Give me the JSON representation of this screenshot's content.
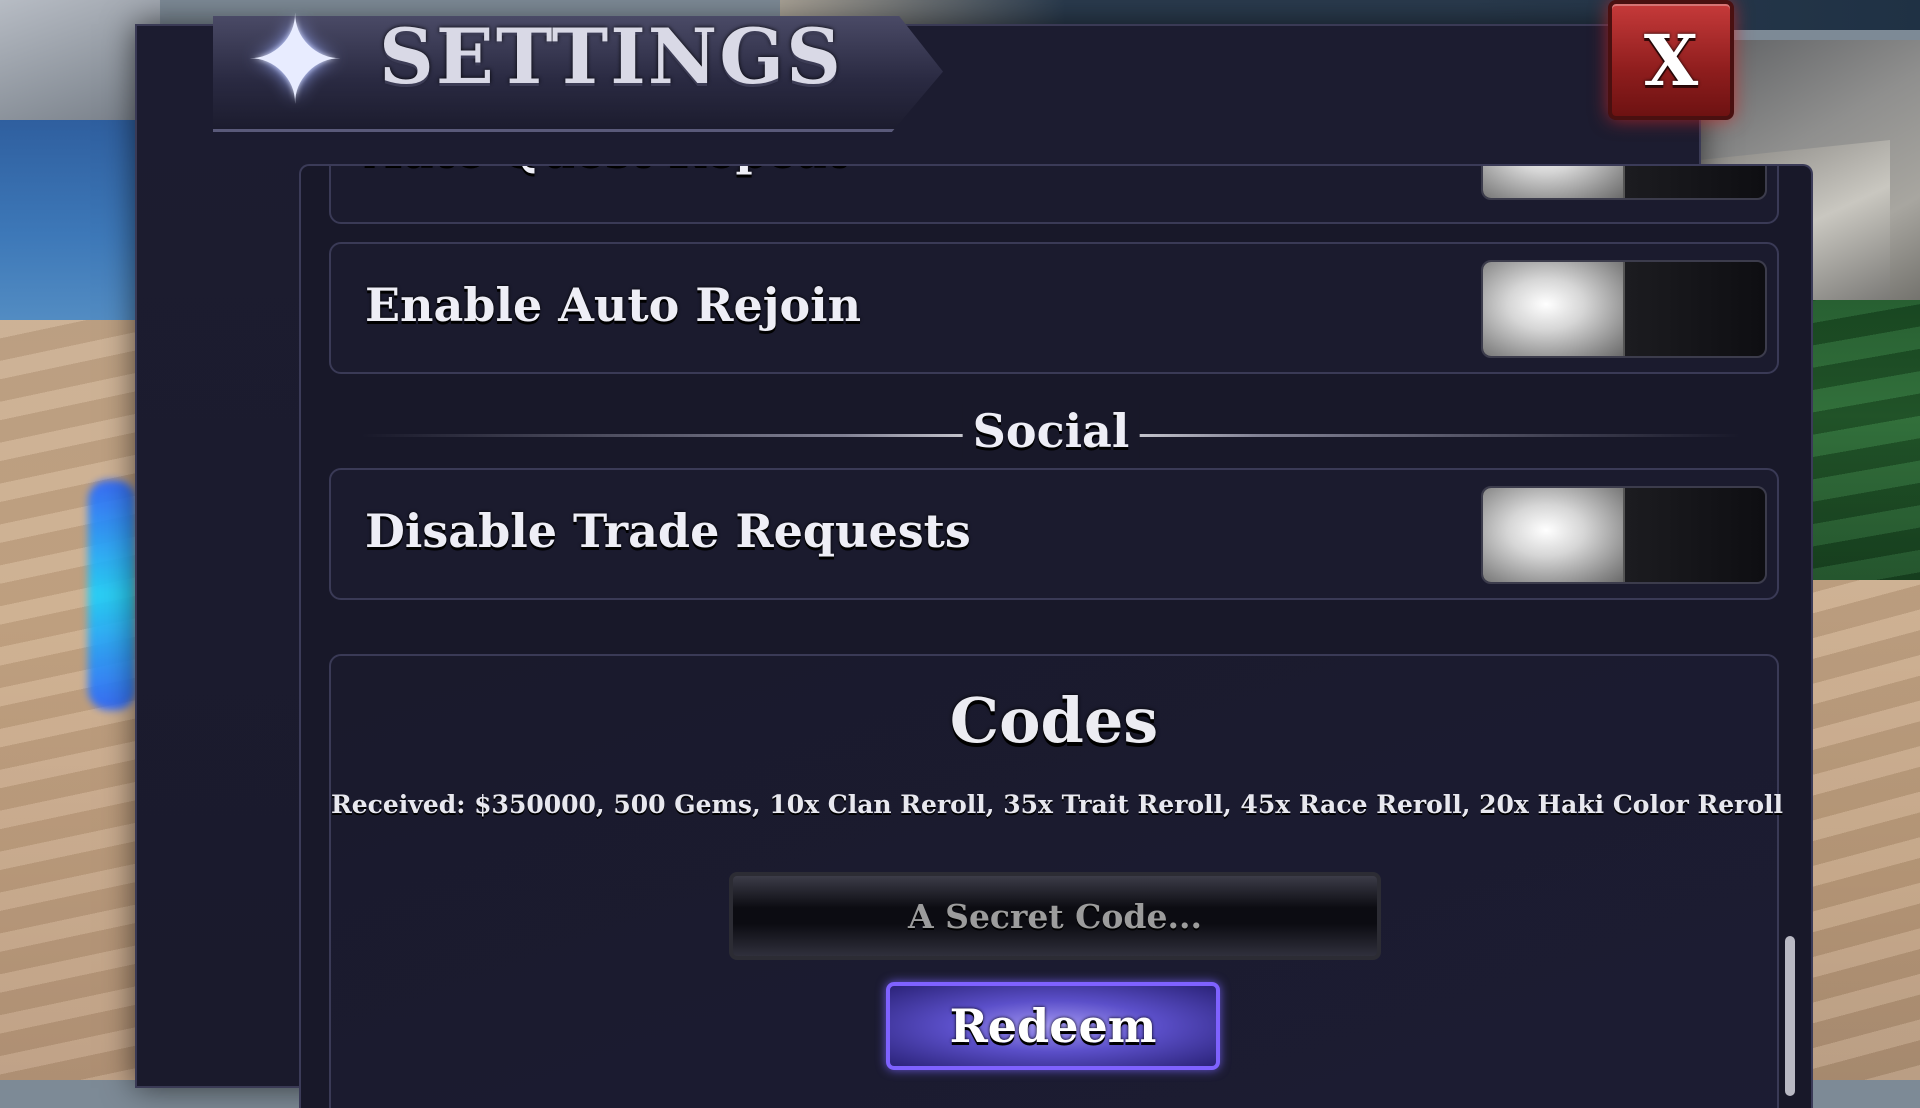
{
  "window": {
    "title": "SETTINGS",
    "close_label": "X"
  },
  "settings": {
    "rows": [
      {
        "label": "Auto Quest Repeat",
        "enabled": false
      },
      {
        "label": "Enable Auto Rejoin",
        "enabled": false
      }
    ],
    "social": {
      "section_label": "Social",
      "rows": [
        {
          "label": "Disable Trade Requests",
          "enabled": false
        }
      ]
    }
  },
  "codes": {
    "title": "Codes",
    "received": "Received: $350000, 500 Gems, 10x Clan Reroll, 35x Trait Reroll, 45x Race Reroll, 20x Haki Color Reroll",
    "input_placeholder": "A Secret Code...",
    "input_value": "",
    "redeem_label": "Redeem"
  },
  "icons": {
    "header": "four-point-star-icon",
    "close": "close-icon"
  },
  "colors": {
    "panel_bg": "#1b1b2e",
    "close_red": "#b32c2c",
    "redeem_purple": "#5b4fc9",
    "redeem_border": "#7f62ff"
  }
}
